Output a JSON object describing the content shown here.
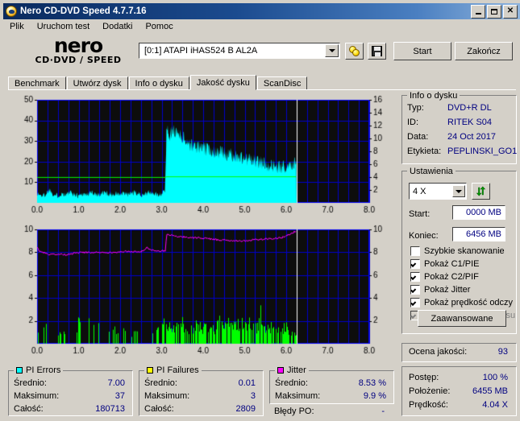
{
  "window": {
    "title": "Nero CD-DVD Speed 4.7.7.16",
    "icon": "nero-globe-icon",
    "buttons": {
      "minimize": "minimize-icon",
      "maximize": "maximize-icon",
      "close": "close-icon"
    }
  },
  "menu": {
    "items": [
      "Plik",
      "Uruchom test",
      "Dodatki",
      "Pomoc"
    ]
  },
  "logo": {
    "line1": "nero",
    "line2": "CD·DVD ∕ SPEED"
  },
  "toolbar": {
    "drive": "[0:1]   ATAPI iHAS524  B AL2A",
    "eject_icon": "disc-icon",
    "save_icon": "floppy-save-icon",
    "start_label": "Start",
    "quit_label": "Zakończ"
  },
  "tabs": [
    {
      "label": "Benchmark",
      "active": false
    },
    {
      "label": "Utwórz dysk",
      "active": false
    },
    {
      "label": "Info o dysku",
      "active": false
    },
    {
      "label": "Jakość dysku",
      "active": true
    },
    {
      "label": "ScanDisc",
      "active": false
    }
  ],
  "disc_info": {
    "caption": "Info o dysku",
    "rows": [
      {
        "label": "Typ:",
        "value": "DVD+R DL"
      },
      {
        "label": "ID:",
        "value": "RITEK S04"
      },
      {
        "label": "Data:",
        "value": "24 Oct 2017"
      },
      {
        "label": "Etykieta:",
        "value": "PEPLINSKI_GO1"
      }
    ]
  },
  "settings": {
    "caption": "Ustawienia",
    "speed": "4 X",
    "refresh_icon": "refresh-icon",
    "start_label": "Start:",
    "start_value": "0000 MB",
    "end_label": "Koniec:",
    "end_value": "6456 MB",
    "checkboxes": [
      {
        "label": "Szybkie skanowanie",
        "checked": false,
        "disabled": false
      },
      {
        "label": "Pokaż C1/PIE",
        "checked": true,
        "disabled": false
      },
      {
        "label": "Pokaż C2/PIF",
        "checked": true,
        "disabled": false
      },
      {
        "label": "Pokaż Jitter",
        "checked": true,
        "disabled": false
      },
      {
        "label": "Pokaż prędkość odczy",
        "checked": true,
        "disabled": false
      },
      {
        "label": "Pokaż prędkość zapisu",
        "checked": true,
        "disabled": true
      }
    ],
    "advanced_label": "Zaawansowane"
  },
  "quality": {
    "label": "Ocena jakości:",
    "value": "93"
  },
  "progress": {
    "rows": [
      {
        "label": "Postęp:",
        "value": "100 %"
      },
      {
        "label": "Położenie:",
        "value": "6455 MB"
      },
      {
        "label": "Prędkość:",
        "value": "4.04 X"
      }
    ]
  },
  "stats": {
    "pi_errors": {
      "caption": "PI Errors",
      "color": "#00ffff",
      "rows": [
        {
          "label": "Średnio:",
          "value": "7.00"
        },
        {
          "label": "Maksimum:",
          "value": "37"
        },
        {
          "label": "Całość:",
          "value": "180713"
        }
      ]
    },
    "pi_failures": {
      "caption": "PI Failures",
      "color": "#ffff00",
      "rows": [
        {
          "label": "Średnio:",
          "value": "0.01"
        },
        {
          "label": "Maksimum:",
          "value": "3"
        },
        {
          "label": "Całość:",
          "value": "2809"
        }
      ]
    },
    "jitter": {
      "caption": "Jitter",
      "color": "#ff00ff",
      "rows": [
        {
          "label": "Średnio:",
          "value": "8.53 %"
        },
        {
          "label": "Maksimum:",
          "value": "9.9 %"
        }
      ]
    },
    "po_errors": {
      "label": "Błędy PO:",
      "value": "-"
    }
  },
  "chart_data": [
    {
      "type": "area",
      "name": "pi-errors-chart",
      "title": "",
      "xlabel": "",
      "ylabel": "PI Errors",
      "xlim": [
        0,
        8
      ],
      "ylim": [
        0,
        50
      ],
      "y2lim": [
        0,
        16
      ],
      "xticks": [
        0.0,
        1.0,
        2.0,
        3.0,
        4.0,
        5.0,
        6.0,
        7.0,
        8.0
      ],
      "xticklabels": [
        "0.0",
        "1.0",
        "2.0",
        "3.0",
        "4.0",
        "5.0",
        "6.0",
        "7.0",
        "8.0"
      ],
      "yticks": [
        10,
        20,
        30,
        40,
        50
      ],
      "yticklabels": [
        "10",
        "20",
        "30",
        "40",
        "50"
      ],
      "y2ticks": [
        2,
        4,
        6,
        8,
        10,
        12,
        14,
        16
      ],
      "y2ticklabels": [
        "2",
        "4",
        "6",
        "8",
        "10",
        "12",
        "14",
        "16"
      ],
      "grid": true,
      "scan_end_gb": 6.25,
      "layer_break_gb": 3.1,
      "series": [
        {
          "name": "PI Errors",
          "color": "#00ffff",
          "kind": "area",
          "x": [
            0.0,
            0.1,
            0.2,
            0.3,
            0.4,
            0.5,
            0.6,
            0.7,
            0.8,
            0.9,
            1.0,
            1.1,
            1.2,
            1.3,
            1.4,
            1.5,
            1.6,
            1.7,
            1.8,
            1.9,
            2.0,
            2.1,
            2.2,
            2.3,
            2.4,
            2.5,
            2.6,
            2.7,
            2.8,
            2.9,
            3.0,
            3.08,
            3.12,
            3.2,
            3.3,
            3.4,
            3.5,
            3.6,
            3.7,
            3.8,
            3.9,
            4.0,
            4.1,
            4.2,
            4.3,
            4.4,
            4.5,
            4.6,
            4.7,
            4.8,
            4.9,
            5.0,
            5.1,
            5.2,
            5.3,
            5.4,
            5.5,
            5.6,
            5.7,
            5.8,
            5.9,
            6.0,
            6.1,
            6.2,
            6.25
          ],
          "values": [
            4.5,
            3.5,
            4.0,
            6.5,
            4.0,
            3.5,
            4.5,
            4.0,
            5.0,
            4.0,
            3.5,
            4.5,
            4.0,
            5.0,
            4.5,
            4.0,
            5.0,
            4.5,
            4.0,
            4.5,
            4.0,
            4.5,
            4.0,
            5.0,
            4.5,
            4.0,
            4.5,
            5.0,
            4.5,
            4.0,
            4.5,
            5.5,
            36.5,
            33.0,
            35.0,
            34.0,
            32.0,
            30.0,
            28.0,
            27.5,
            27.0,
            26.5,
            26.0,
            25.5,
            25.0,
            24.5,
            24.0,
            23.5,
            23.0,
            22.5,
            22.0,
            21.5,
            21.0,
            20.5,
            20.0,
            19.5,
            19.0,
            18.5,
            18.0,
            17.5,
            17.0,
            18.0,
            19.0,
            20.0,
            19.5
          ],
          "note": "peaks reach ~37 just after layer break at 3.1 GB; baseline ~4 on layer 0"
        },
        {
          "name": "Prędkość odczytu",
          "color": "#00ff00",
          "kind": "line",
          "axis": "y2",
          "x": [
            0.0,
            3.09,
            3.11,
            6.25
          ],
          "values": [
            3.95,
            3.95,
            4.05,
            4.05
          ],
          "note": "read speed ~4X flat across scan"
        }
      ]
    },
    {
      "type": "area",
      "name": "pi-failures-jitter-chart",
      "title": "",
      "xlabel": "",
      "ylabel": "PI Failures",
      "xlim": [
        0,
        8
      ],
      "ylim": [
        0,
        10
      ],
      "y2lim": [
        0,
        10
      ],
      "xticks": [
        0.0,
        1.0,
        2.0,
        3.0,
        4.0,
        5.0,
        6.0,
        7.0,
        8.0
      ],
      "xticklabels": [
        "0.0",
        "1.0",
        "2.0",
        "3.0",
        "4.0",
        "5.0",
        "6.0",
        "7.0",
        "8.0"
      ],
      "yticks": [
        2,
        4,
        6,
        8,
        10
      ],
      "yticklabels": [
        "2",
        "4",
        "6",
        "8",
        "10"
      ],
      "y2ticks": [
        2,
        4,
        6,
        8,
        10
      ],
      "y2ticklabels": [
        "2",
        "4",
        "6",
        "8",
        "10"
      ],
      "grid": true,
      "scan_end_gb": 6.25,
      "layer_break_gb": 3.1,
      "series": [
        {
          "name": "PI Failures",
          "color": "#00ff00",
          "kind": "spikes",
          "x": [
            0.0,
            0.3,
            0.45,
            0.55,
            0.95,
            1.0,
            1.05,
            1.15,
            1.25,
            1.65,
            1.7,
            1.8,
            1.9,
            2.1,
            2.3,
            2.55,
            2.7,
            2.75,
            3.0,
            3.1,
            3.2,
            3.3,
            3.4,
            3.5,
            3.6,
            3.7,
            3.8,
            3.9,
            4.0,
            4.1,
            4.2,
            4.3,
            4.4,
            4.5,
            4.6,
            4.7,
            4.8,
            4.9,
            5.0,
            5.1,
            5.2,
            5.3,
            5.4,
            5.45,
            5.5,
            5.6,
            5.7,
            5.8,
            5.9,
            6.0,
            6.1,
            6.2
          ],
          "values": [
            1.0,
            2.0,
            1.0,
            1.0,
            1.5,
            2.0,
            2.0,
            2.0,
            2.0,
            2.0,
            1.5,
            2.0,
            1.5,
            1.0,
            1.0,
            1.0,
            3.0,
            1.0,
            1.5,
            2.0,
            1.5,
            1.5,
            1.5,
            2.0,
            1.5,
            1.5,
            2.0,
            1.5,
            1.5,
            2.0,
            1.5,
            1.5,
            2.0,
            1.5,
            2.0,
            1.5,
            1.5,
            2.0,
            1.5,
            2.0,
            1.5,
            1.5,
            3.0,
            2.0,
            1.5,
            1.5,
            2.0,
            1.5,
            1.5,
            1.5,
            1.0,
            1.0
          ],
          "note": "dense green spikes mostly 1-2, max 3"
        },
        {
          "name": "Jitter",
          "color": "#ff00ff",
          "kind": "line",
          "axis": "y2",
          "x": [
            0.0,
            0.05,
            0.15,
            0.3,
            0.5,
            0.7,
            0.9,
            1.1,
            1.3,
            1.5,
            1.7,
            1.9,
            2.1,
            2.3,
            2.5,
            2.65,
            2.7,
            2.85,
            3.05,
            3.09,
            3.12,
            3.2,
            3.35,
            3.5,
            3.7,
            3.9,
            4.1,
            4.3,
            4.5,
            4.7,
            4.9,
            5.1,
            5.3,
            5.5,
            5.7,
            5.9,
            6.05,
            6.15,
            6.25
          ],
          "values": [
            8.4,
            8.1,
            8.0,
            7.8,
            7.8,
            7.8,
            7.9,
            8.0,
            7.95,
            8.0,
            8.0,
            8.0,
            8.05,
            8.05,
            8.05,
            8.4,
            8.2,
            8.15,
            8.1,
            8.1,
            9.6,
            9.5,
            9.4,
            9.35,
            9.3,
            9.25,
            9.2,
            9.1,
            9.05,
            9.0,
            9.0,
            9.05,
            9.1,
            9.15,
            9.2,
            9.3,
            9.5,
            9.7,
            9.9
          ],
          "note": "jitter ~8% on layer 0, jumps to ~9.5% after layer break, rises to 9.9% at end"
        }
      ]
    }
  ]
}
